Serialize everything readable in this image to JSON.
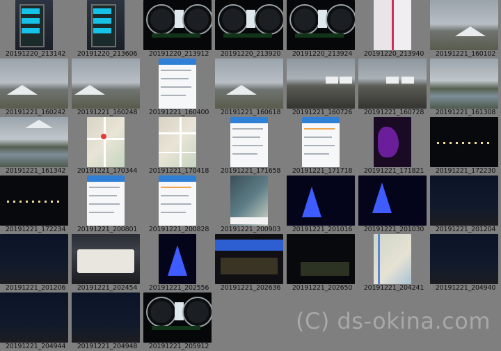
{
  "watermark": "(C) ds-okina.com",
  "thumbnails": [
    "20191220_213142",
    "20191220_213606",
    "20191220_213912",
    "20191220_213920",
    "20191220_213924",
    "20191220_213940",
    "20191221_160102",
    "20191221_160242",
    "20191221_160248",
    "20191221_160400",
    "20191221_160618",
    "20191221_160726",
    "20191221_160728",
    "20191221_161308",
    "20191221_161342",
    "20191221_170344",
    "20191221_170418",
    "20191221_171658",
    "20191221_171718",
    "20191221_171821",
    "20191221_172230",
    "20191221_172234",
    "20191221_200801",
    "20191221_200828",
    "20191221_200903",
    "20191221_201016",
    "20191221_201030",
    "20191221_201204",
    "20191221_201206",
    "20191221_202454",
    "20191221_202556",
    "20191221_202636",
    "20191221_202650",
    "20191221_204241",
    "20191221_204940",
    "20191221_204944",
    "20191221_204948",
    "20191221_205912"
  ]
}
